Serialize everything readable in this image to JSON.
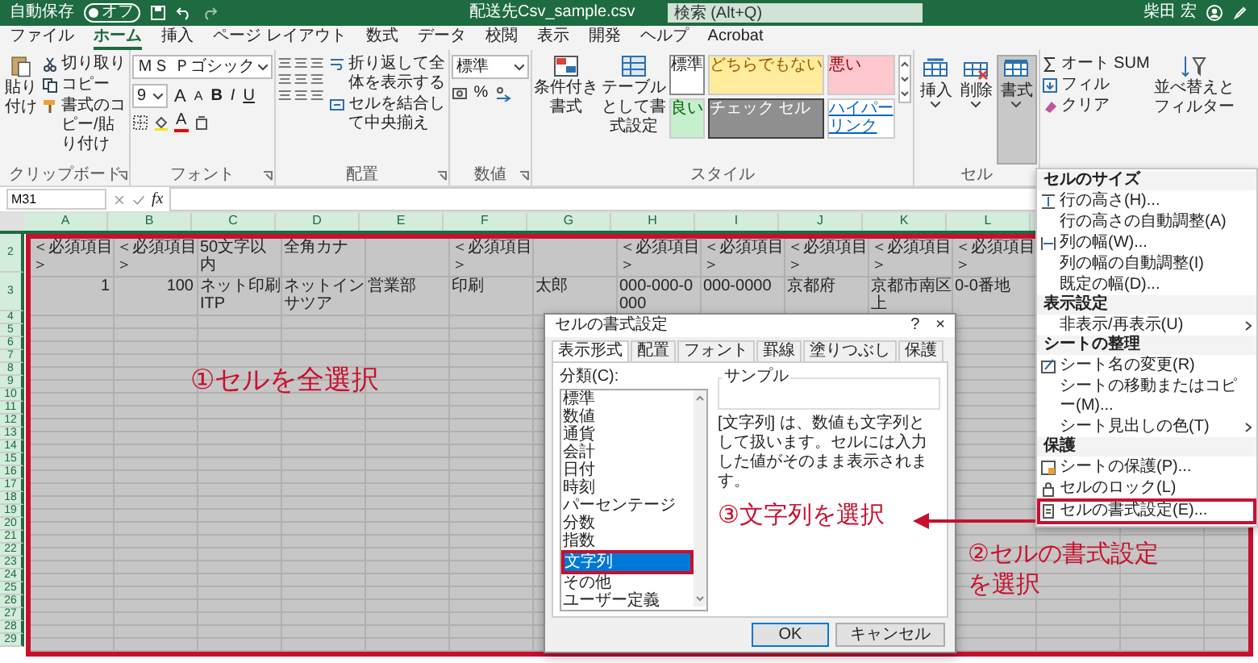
{
  "title_bar": {
    "autosave_label": "自動保存",
    "autosave_toggle": {
      "label": "オフ",
      "on": false
    },
    "file_name": "配送先Csv_sample.csv",
    "search": {
      "placeholder": "検索 (Alt+Q)"
    },
    "user_name": "柴田 宏"
  },
  "menu_tabs": [
    {
      "label": "ファイル",
      "selected": false
    },
    {
      "label": "ホーム",
      "selected": true
    },
    {
      "label": "挿入",
      "selected": false
    },
    {
      "label": "ページ レイアウト",
      "selected": false
    },
    {
      "label": "数式",
      "selected": false
    },
    {
      "label": "データ",
      "selected": false
    },
    {
      "label": "校閲",
      "selected": false
    },
    {
      "label": "表示",
      "selected": false
    },
    {
      "label": "開発",
      "selected": false
    },
    {
      "label": "ヘルプ",
      "selected": false
    },
    {
      "label": "Acrobat",
      "selected": false
    }
  ],
  "ribbon": {
    "clipboard": {
      "label": "クリップボード",
      "paste": "貼り付け",
      "cut": "切り取り",
      "copy": "コピー",
      "format_painter": "書式のコピー/貼り付け"
    },
    "font": {
      "label": "フォント",
      "font_name": "ＭＳ Ｐゴシック",
      "font_size": "9",
      "grow": "A",
      "shrink": "A",
      "bold": "B",
      "italic": "I",
      "underline": "U",
      "font_color": "A"
    },
    "alignment": {
      "label": "配置",
      "wrap_text": "折り返して全体を表示する",
      "merge_center": "セルを結合して中央揃え"
    },
    "number": {
      "label": "数値",
      "format": "標準",
      "percent": "%"
    },
    "styles": {
      "label": "スタイル",
      "conditional": "条件付き書式",
      "as_table": "テーブルとして書式設定",
      "cell_styles": [
        {
          "label": "標準",
          "kind": "normal"
        },
        {
          "label": "どちらでもない",
          "kind": "neutral"
        },
        {
          "label": "悪い",
          "kind": "bad"
        },
        {
          "label": "良い",
          "kind": "good"
        },
        {
          "label": "チェック セル",
          "kind": "check"
        },
        {
          "label": "ハイパーリンク",
          "kind": "link"
        }
      ]
    },
    "cells": {
      "label": "セル",
      "buttons": [
        {
          "label": "挿入",
          "kind": "insert",
          "selected": false
        },
        {
          "label": "削除",
          "kind": "delete",
          "selected": false
        },
        {
          "label": "書式",
          "kind": "format",
          "selected": true
        }
      ]
    },
    "editing": {
      "autosum": "オート SUM",
      "fill": "フィル",
      "clear": "クリア",
      "sort_filter": "並べ替えとフィルター"
    }
  },
  "formula_bar": {
    "name_box": "M31",
    "function_label": "fx"
  },
  "sheet": {
    "all_selected": true,
    "annotated": true,
    "columns": [
      "A",
      "B",
      "C",
      "D",
      "E",
      "F",
      "G",
      "H",
      "I",
      "J",
      "K",
      "L"
    ],
    "rows": [
      {
        "number": "2",
        "cells": [
          "＜必須項目＞",
          "＜必須項目＞",
          "50文字以内",
          "全角カナ",
          null,
          "＜必須項目＞",
          null,
          "＜必須項目＞",
          "＜必須項目＞",
          "＜必須項目＞",
          "＜必須項目＞",
          "＜必須項目＞"
        ]
      },
      {
        "number": "3",
        "cells": [
          "1",
          "100",
          "ネット印刷ITP",
          "ネットインサツア",
          "営業部",
          "印刷",
          "太郎",
          "000-000-0000",
          "000-0000",
          "京都府",
          "京都市南区上",
          "0-0番地"
        ]
      },
      {
        "number": "4"
      },
      {
        "number": "5"
      },
      {
        "number": "6"
      },
      {
        "number": "7"
      },
      {
        "number": "8"
      },
      {
        "number": "9"
      },
      {
        "number": "10"
      },
      {
        "number": "11"
      },
      {
        "number": "12"
      },
      {
        "number": "13"
      },
      {
        "number": "14"
      },
      {
        "number": "15"
      },
      {
        "number": "16"
      },
      {
        "number": "17"
      },
      {
        "number": "18"
      },
      {
        "number": "19"
      },
      {
        "number": "20"
      },
      {
        "number": "21"
      },
      {
        "number": "22"
      },
      {
        "number": "23"
      },
      {
        "number": "24"
      },
      {
        "number": "25"
      },
      {
        "number": "26"
      },
      {
        "number": "27"
      },
      {
        "number": "28"
      },
      {
        "number": "29"
      }
    ]
  },
  "dialog": {
    "title": "セルの書式設定",
    "help": "?",
    "close": "×",
    "tabs": [
      {
        "label": "表示形式",
        "selected": true
      },
      {
        "label": "配置",
        "selected": false
      },
      {
        "label": "フォント",
        "selected": false
      },
      {
        "label": "罫線",
        "selected": false
      },
      {
        "label": "塗りつぶし",
        "selected": false
      },
      {
        "label": "保護",
        "selected": false
      }
    ],
    "category_label": "分類(C):",
    "categories": [
      {
        "label": "標準",
        "selected": false,
        "annotated": false
      },
      {
        "label": "数値",
        "selected": false,
        "annotated": false
      },
      {
        "label": "通貨",
        "selected": false,
        "annotated": false
      },
      {
        "label": "会計",
        "selected": false,
        "annotated": false
      },
      {
        "label": "日付",
        "selected": false,
        "annotated": false
      },
      {
        "label": "時刻",
        "selected": false,
        "annotated": false
      },
      {
        "label": "パーセンテージ",
        "selected": false,
        "annotated": false
      },
      {
        "label": "分数",
        "selected": false,
        "annotated": false
      },
      {
        "label": "指数",
        "selected": false,
        "annotated": false
      },
      {
        "label": "文字列",
        "selected": true,
        "annotated": true
      },
      {
        "label": "その他",
        "selected": false,
        "annotated": false
      },
      {
        "label": "ユーザー定義",
        "selected": false,
        "annotated": false
      }
    ],
    "sample_label": "サンプル",
    "description": "[文字列] は、数値も文字列として扱います。セルには入力した値がそのまま表示されます。",
    "buttons": [
      {
        "label": "OK",
        "kind": "default"
      },
      {
        "label": "キャンセル",
        "kind": "normal"
      }
    ]
  },
  "context_menu": {
    "sections": [
      {
        "heading": "セルのサイズ",
        "items": [
          {
            "label": "行の高さ(H)...",
            "kind": "row_height",
            "submenu": false,
            "annotated": false
          },
          {
            "label": "行の高さの自動調整(A)",
            "kind": "plain",
            "submenu": false,
            "annotated": false
          },
          {
            "label": "列の幅(W)...",
            "kind": "col_width",
            "submenu": false,
            "annotated": false
          },
          {
            "label": "列の幅の自動調整(I)",
            "kind": "plain",
            "submenu": false,
            "annotated": false
          },
          {
            "label": "既定の幅(D)...",
            "kind": "plain",
            "submenu": false,
            "annotated": false
          }
        ]
      },
      {
        "heading": "表示設定",
        "items": [
          {
            "label": "非表示/再表示(U)",
            "kind": "plain",
            "submenu": true,
            "annotated": false
          }
        ]
      },
      {
        "heading": "シートの整理",
        "items": [
          {
            "label": "シート名の変更(R)",
            "kind": "rename",
            "submenu": false,
            "annotated": false
          },
          {
            "label": "シートの移動またはコピー(M)...",
            "kind": "plain",
            "submenu": false,
            "annotated": false
          },
          {
            "label": "シート見出しの色(T)",
            "kind": "plain",
            "submenu": true,
            "annotated": false
          }
        ]
      },
      {
        "heading": "保護",
        "items": [
          {
            "label": "シートの保護(P)...",
            "kind": "protect",
            "submenu": false,
            "annotated": false
          },
          {
            "label": "セルのロック(L)",
            "kind": "lock",
            "submenu": false,
            "annotated": false
          },
          {
            "label": "セルの書式設定(E)...",
            "kind": "format",
            "submenu": false,
            "annotated": true
          }
        ]
      }
    ]
  },
  "annotations": {
    "step1": "①セルを全選択",
    "step2": [
      "②セルの書式設定",
      "を選択"
    ],
    "step3": "③文字列を選択"
  }
}
